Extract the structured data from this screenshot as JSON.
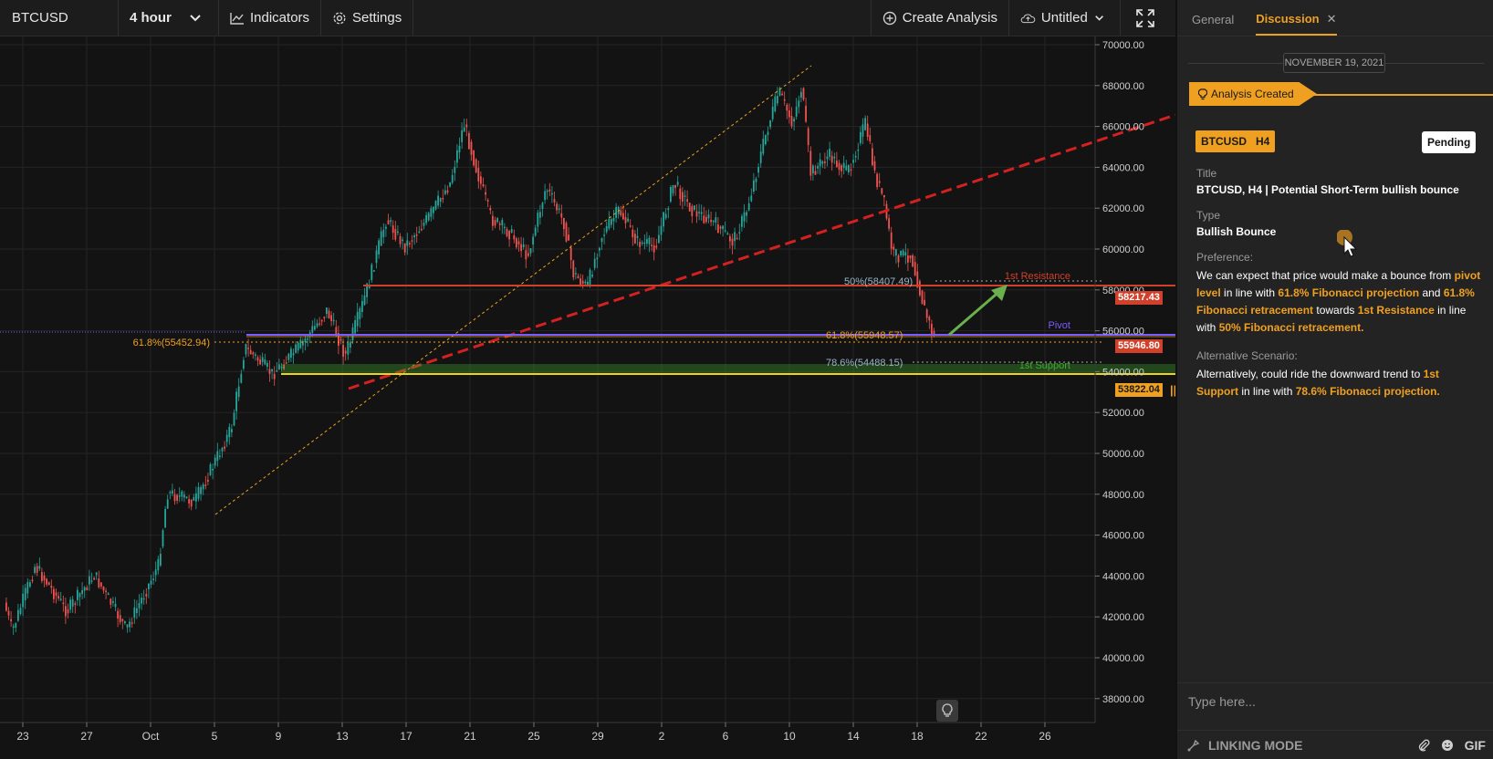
{
  "toolbar": {
    "symbol": "BTCUSD",
    "interval": "4 hour",
    "indicators_label": "Indicators",
    "settings_label": "Settings",
    "create_analysis_label": "Create Analysis",
    "untitled_label": "Untitled"
  },
  "chart": {
    "price_axis": [
      "70000.00",
      "68000.00",
      "66000.00",
      "64000.00",
      "62000.00",
      "60000.00",
      "58000.00",
      "56000.00",
      "54000.00",
      "52000.00",
      "50000.00",
      "48000.00",
      "46000.00",
      "44000.00",
      "42000.00",
      "40000.00",
      "38000.00"
    ],
    "date_axis": [
      "23",
      "27",
      "Oct",
      "5",
      "9",
      "13",
      "17",
      "21",
      "25",
      "29",
      "2",
      "6",
      "10",
      "14",
      "18",
      "22",
      "26"
    ],
    "levels": {
      "resistance_label": "1st Resistance",
      "pivot_label": "Pivot",
      "support_label": "1st Support",
      "fib50_label": "50%(58407.49)",
      "fib618_proj_label": "61.8%(55452.94)",
      "fib618_ret_label": "61.8%(55948.57)",
      "fib786_label": "78.6%(54488.15)"
    },
    "price_tags": {
      "resistance": "58217.43",
      "pivot": "55946.80",
      "support": "53822.04"
    },
    "colors": {
      "up": "#26a69a",
      "down": "#ef5350",
      "resistance": "#d0402a",
      "pivot": "#7b5cff",
      "support": "#43a832",
      "fib": "#f0a020",
      "trendline": "#d32020",
      "arrow": "#6ab04c"
    }
  },
  "panel": {
    "tabs": [
      "General",
      "Discussion"
    ],
    "date": "NOVEMBER 19, 2021",
    "analysis_created": "Analysis Created",
    "chip_symbol": "BTCUSD",
    "chip_timeframe": "H4",
    "status": "Pending",
    "title_label": "Title",
    "title_value": "BTCUSD, H4 | Potential Short-Term bullish bounce",
    "type_label": "Type",
    "type_value": "Bullish Bounce",
    "preference_label": "Preference:",
    "pref": {
      "t1": "We can expect that price would make a bounce from ",
      "h1": "pivot level",
      "t2": " in line with ",
      "h2": "61.8% Fibonacci projection",
      "t3": " and ",
      "h3": "61.8% Fibonacci retracement",
      "t4": " towards ",
      "h4": "1st Resistance",
      "t5": " in line with ",
      "h5": "50% Fibonacci retracement."
    },
    "alt_label": "Alternative Scenario:",
    "alt": {
      "t1": "Alternatively, could ride the downward trend to ",
      "h1": "1st Support",
      "t2": " in line with ",
      "h2": "78.6% Fibonacci projection."
    },
    "composer_placeholder": "Type here...",
    "linking_mode": "LINKING MODE",
    "gif_label": "GIF"
  }
}
